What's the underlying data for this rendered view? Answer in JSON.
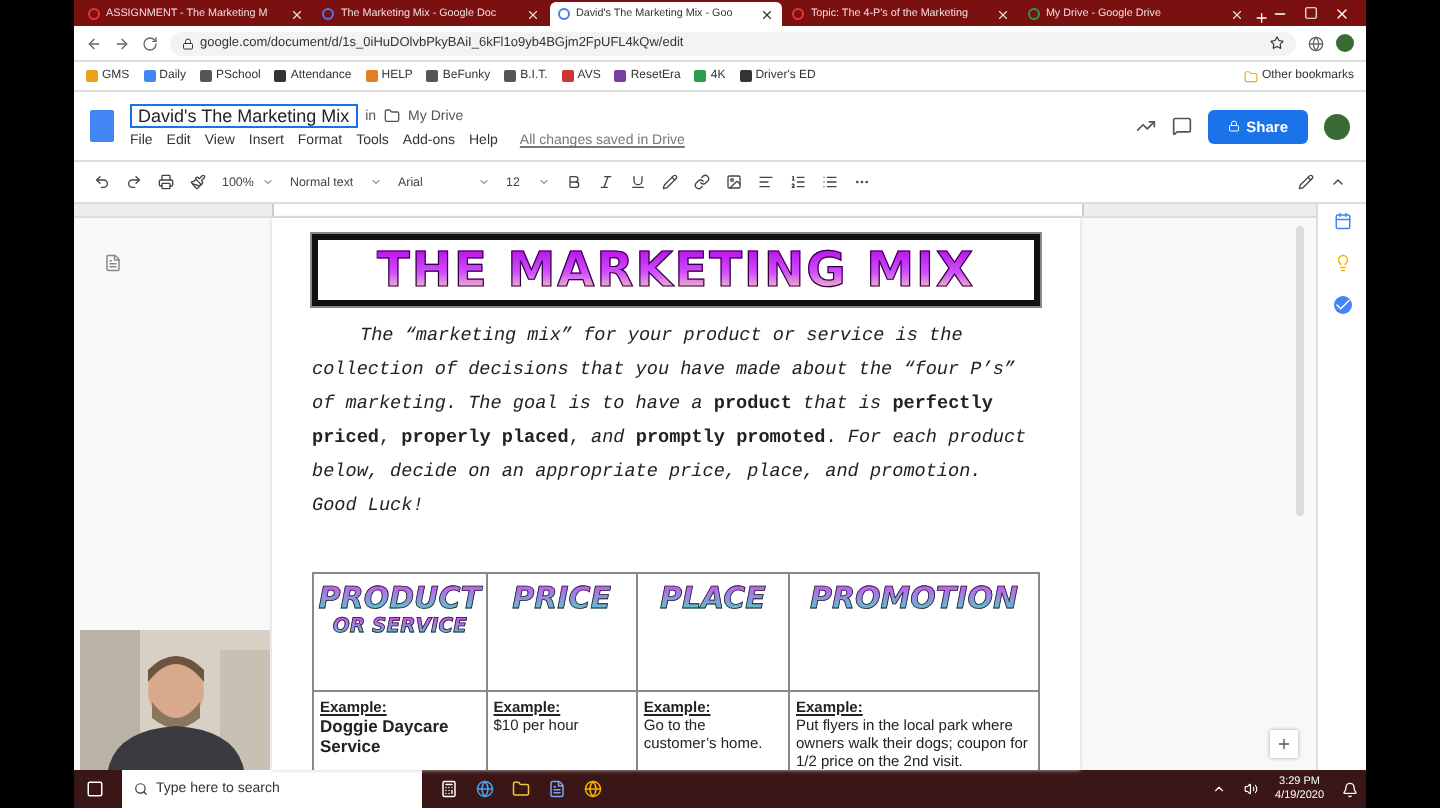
{
  "browser": {
    "tabs": [
      {
        "title": "ASSIGNMENT - The Marketing M",
        "selected": false
      },
      {
        "title": "The Marketing Mix - Google Doc",
        "selected": false
      },
      {
        "title": "David's The Marketing Mix - Goo",
        "selected": true
      },
      {
        "title": "Topic: The 4-P's of the Marketing",
        "selected": false
      },
      {
        "title": "My Drive - Google Drive",
        "selected": false
      }
    ],
    "url": "google.com/document/d/1s_0iHuDOlvbPkyBAiI_6kFl1o9yb4BGjm2FpUFL4kQw/edit",
    "bookmarks": [
      "GMS",
      "Daily",
      "PSchool",
      "Attendance",
      "HELP",
      "BeFunky",
      "B.I.T.",
      "AVS",
      "ResetEra",
      "4K",
      "Driver's ED"
    ],
    "other_bookmarks": "Other bookmarks"
  },
  "docs": {
    "title": "David's The Marketing Mix",
    "in": "in",
    "folder": "My Drive",
    "menu": [
      "File",
      "Edit",
      "View",
      "Insert",
      "Format",
      "Tools",
      "Add-ons",
      "Help"
    ],
    "save_status": "All changes saved in Drive",
    "share": "Share",
    "toolbar": {
      "zoom": "100%",
      "style": "Normal text",
      "font": "Arial",
      "size": "12"
    }
  },
  "document": {
    "banner": "THE MARKETING MIX",
    "intro": "*The “marketing mix” for your product or service is the collection of decisions that you have made about the “four P’s” of marketing. The goal is to have a* **product** *that is* **perfectly priced**, **properly placed**, *and* **promptly promoted**. *For each product below, decide on an appropriate price, place, and promotion.*",
    "closing": "Good Luck!",
    "table": {
      "columns": [
        {
          "title": "PRODUCT",
          "subtitle": "OR SERVICE"
        },
        {
          "title": "PRICE"
        },
        {
          "title": "PLACE"
        },
        {
          "title": "PROMOTION"
        }
      ],
      "rows": [
        [
          {
            "label": "Example:",
            "text": "Doggie Daycare Service",
            "bold": true
          },
          {
            "label": "Example:",
            "text": "$10 per hour",
            "bold": false
          },
          {
            "label": "Example:",
            "text": "Go to the customer’s home.",
            "bold": false
          },
          {
            "label": "Example:",
            "text": "Put flyers in the local park where owners walk their dogs; coupon for 1/2 price on the 2nd visit.",
            "bold": false
          }
        ]
      ]
    }
  },
  "taskbar": {
    "search_placeholder": "Type here to search",
    "time": "3:29 PM",
    "date": "4/19/2020"
  }
}
